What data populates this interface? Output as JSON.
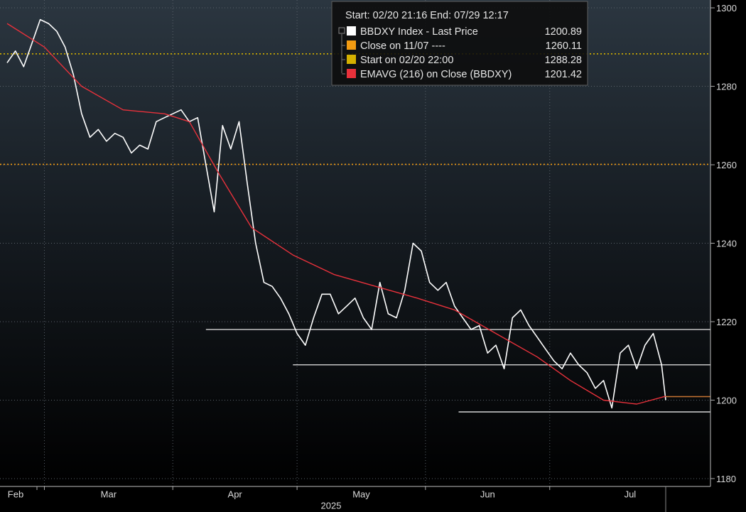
{
  "chart_data": {
    "type": "line",
    "x_start": "2025-02-20",
    "x_end": "2025-07-29",
    "year_label": "2025",
    "month_ticks": [
      {
        "label": "Feb",
        "date": "2025-02-20"
      },
      {
        "label": "Mar",
        "date": "2025-03-01"
      },
      {
        "label": "Apr",
        "date": "2025-04-01"
      },
      {
        "label": "May",
        "date": "2025-05-01"
      },
      {
        "label": "Jun",
        "date": "2025-06-01"
      },
      {
        "label": "Jul",
        "date": "2025-07-01"
      }
    ],
    "ylim": [
      1178,
      1302
    ],
    "yticks": [
      1180,
      1200,
      1220,
      1240,
      1260,
      1280,
      1300
    ],
    "legend": {
      "header": "Start: 02/20 21:16 End: 07/29 12:17",
      "items": [
        {
          "label": "BBDXY Index - Last Price",
          "value": "1200.89",
          "color": "#ffffff"
        },
        {
          "label": "Close on 11/07 ----",
          "value": "1260.11",
          "color": "#f39c12"
        },
        {
          "label": "Start on 02/20 22:00",
          "value": "1288.28",
          "color": "#d4b000"
        },
        {
          "label": "EMAVG (216)  on Close (BBDXY)",
          "value": "1201.42",
          "color": "#e8313b"
        }
      ]
    },
    "reference_lines": [
      {
        "name": "Start on 02/20 22:00",
        "y": 1288.28,
        "color": "#d4b000",
        "style": "dotted"
      },
      {
        "name": "Close on 11/07",
        "y": 1260.11,
        "color": "#f39c12",
        "style": "dotted"
      }
    ],
    "support_lines": [
      {
        "from": "2025-04-09",
        "to": "2025-07-29",
        "y": 1218
      },
      {
        "from": "2025-04-30",
        "to": "2025-07-29",
        "y": 1209
      },
      {
        "from": "2025-06-09",
        "to": "2025-07-29",
        "y": 1197
      }
    ],
    "last_price_marker": {
      "y": 1200.89,
      "color": "#c87533"
    },
    "series": [
      {
        "name": "BBDXY Index - Last Price",
        "color": "#ffffff",
        "x": [
          "2025-02-20",
          "2025-02-22",
          "2025-02-24",
          "2025-02-26",
          "2025-02-28",
          "2025-03-02",
          "2025-03-04",
          "2025-03-06",
          "2025-03-08",
          "2025-03-10",
          "2025-03-12",
          "2025-03-14",
          "2025-03-16",
          "2025-03-18",
          "2025-03-20",
          "2025-03-22",
          "2025-03-24",
          "2025-03-26",
          "2025-03-28",
          "2025-03-30",
          "2025-04-01",
          "2025-04-03",
          "2025-04-05",
          "2025-04-07",
          "2025-04-09",
          "2025-04-11",
          "2025-04-13",
          "2025-04-15",
          "2025-04-17",
          "2025-04-19",
          "2025-04-21",
          "2025-04-23",
          "2025-04-25",
          "2025-04-27",
          "2025-04-29",
          "2025-05-01",
          "2025-05-03",
          "2025-05-05",
          "2025-05-07",
          "2025-05-09",
          "2025-05-11",
          "2025-05-13",
          "2025-05-15",
          "2025-05-17",
          "2025-05-19",
          "2025-05-21",
          "2025-05-23",
          "2025-05-25",
          "2025-05-27",
          "2025-05-29",
          "2025-05-31",
          "2025-06-02",
          "2025-06-04",
          "2025-06-06",
          "2025-06-08",
          "2025-06-10",
          "2025-06-12",
          "2025-06-14",
          "2025-06-16",
          "2025-06-18",
          "2025-06-20",
          "2025-06-22",
          "2025-06-24",
          "2025-06-26",
          "2025-06-28",
          "2025-06-30",
          "2025-07-02",
          "2025-07-04",
          "2025-07-06",
          "2025-07-08",
          "2025-07-10",
          "2025-07-12",
          "2025-07-14",
          "2025-07-16",
          "2025-07-18",
          "2025-07-20",
          "2025-07-22",
          "2025-07-24",
          "2025-07-26",
          "2025-07-28",
          "2025-07-29"
        ],
        "values": [
          1286,
          1289,
          1285,
          1291,
          1297,
          1296,
          1294,
          1290,
          1283,
          1273,
          1267,
          1269,
          1266,
          1268,
          1267,
          1263,
          1265,
          1264,
          1271,
          1272,
          1273,
          1274,
          1271,
          1272,
          1260,
          1248,
          1270,
          1264,
          1271,
          1255,
          1240,
          1230,
          1229,
          1226,
          1222,
          1217,
          1214,
          1221,
          1227,
          1227,
          1222,
          1224,
          1226,
          1221,
          1218,
          1230,
          1222,
          1221,
          1228,
          1240,
          1238,
          1230,
          1228,
          1230,
          1224,
          1221,
          1218,
          1219,
          1212,
          1214,
          1208,
          1221,
          1223,
          1219,
          1216,
          1213,
          1210,
          1208,
          1212,
          1209,
          1207,
          1203,
          1205,
          1198,
          1212,
          1214,
          1208,
          1214,
          1217,
          1209,
          1200
        ]
      },
      {
        "name": "EMAVG (216)  on Close (BBDXY)",
        "color": "#e8313b",
        "x": [
          "2025-02-20",
          "2025-03-01",
          "2025-03-10",
          "2025-03-20",
          "2025-03-30",
          "2025-04-05",
          "2025-04-12",
          "2025-04-20",
          "2025-04-30",
          "2025-05-10",
          "2025-05-20",
          "2025-05-30",
          "2025-06-08",
          "2025-06-18",
          "2025-06-28",
          "2025-07-06",
          "2025-07-14",
          "2025-07-22",
          "2025-07-29"
        ],
        "values": [
          1296,
          1290,
          1280,
          1274,
          1273,
          1271,
          1258,
          1244,
          1237,
          1232,
          1229,
          1226,
          1223,
          1217,
          1211,
          1205,
          1200,
          1199,
          1201
        ]
      }
    ]
  }
}
